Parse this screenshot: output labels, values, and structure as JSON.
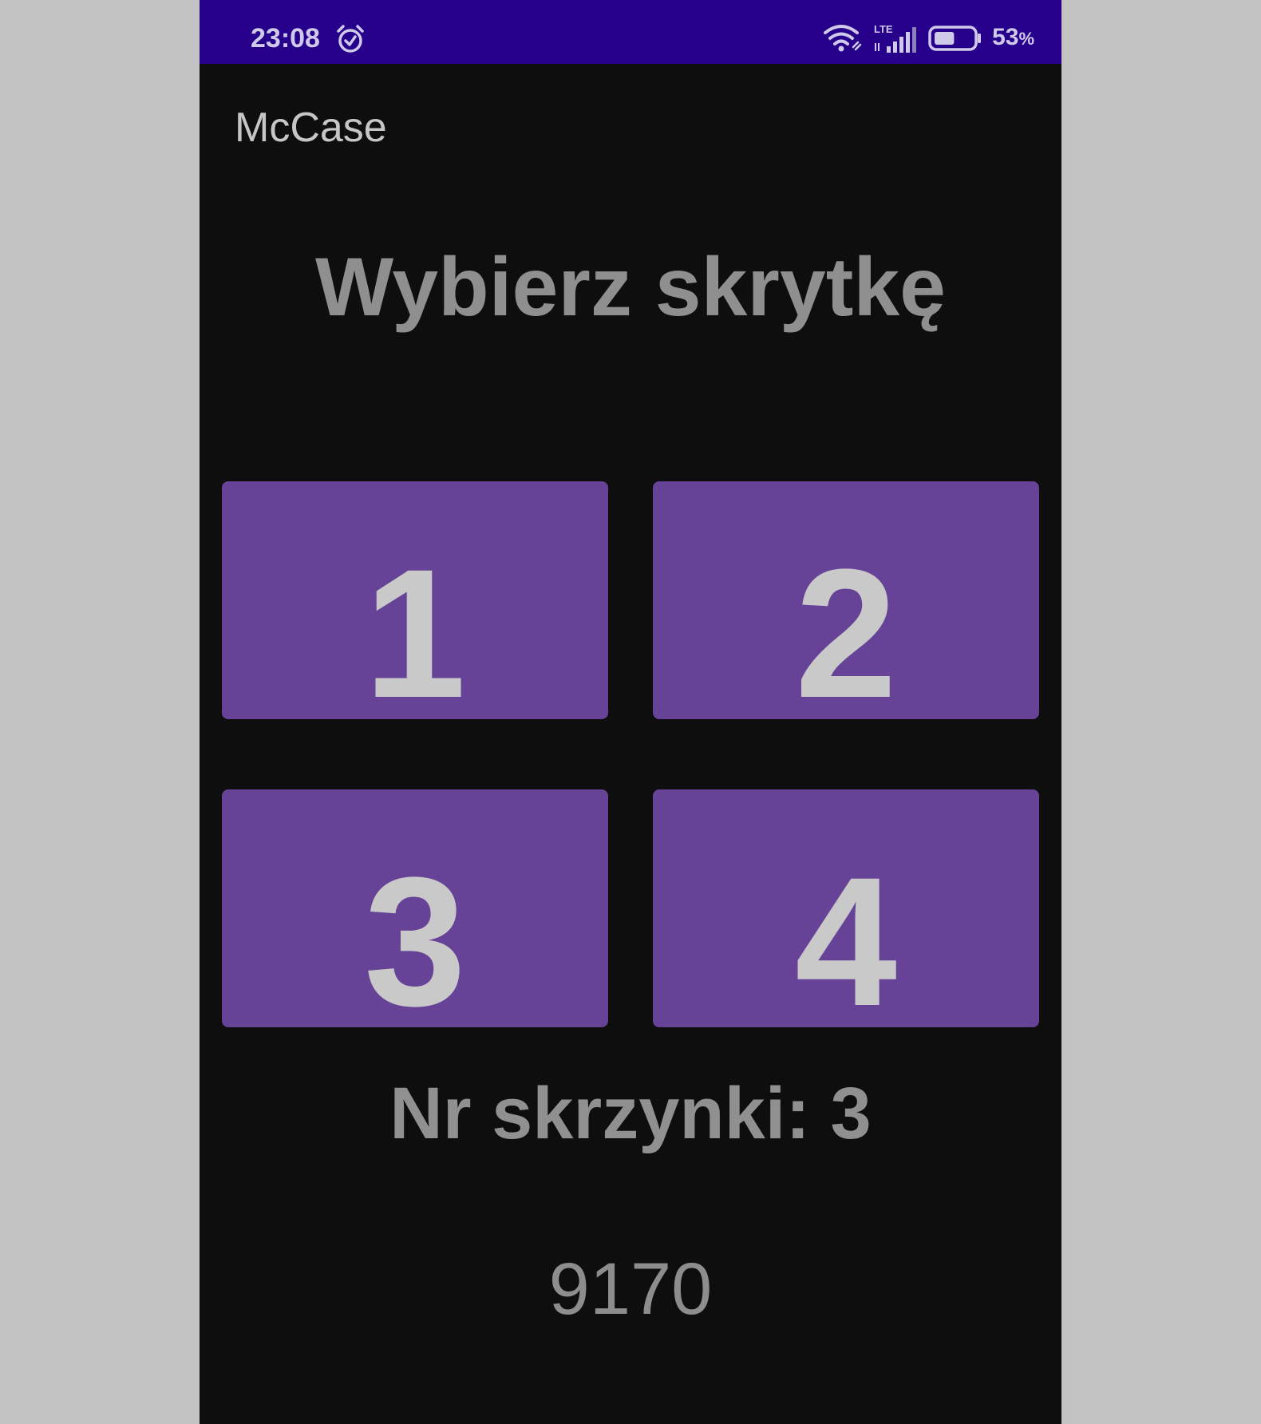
{
  "status_bar": {
    "time": "23:08",
    "icons": [
      "alarm-icon",
      "wifi-icon",
      "lte-signal-icon",
      "battery-icon"
    ],
    "network_type": "LTE",
    "battery_level": 53,
    "battery_value": "53",
    "battery_unit": "%"
  },
  "app": {
    "title": "McCase"
  },
  "main": {
    "heading": "Wybierz skrytkę",
    "lockers": [
      {
        "label": "1"
      },
      {
        "label": "2"
      },
      {
        "label": "3"
      },
      {
        "label": "4"
      }
    ],
    "selected_box_text": "Nr skrzynki: 3",
    "code": "9170"
  },
  "colors": {
    "status_bar_bg": "#26008a",
    "screen_bg": "#0e0e0e",
    "locker_button_bg": "#674398",
    "locker_label": "#c9c9c9",
    "text_gray": "#8f8f8f",
    "letterbox_bg": "#c3c3c3"
  }
}
